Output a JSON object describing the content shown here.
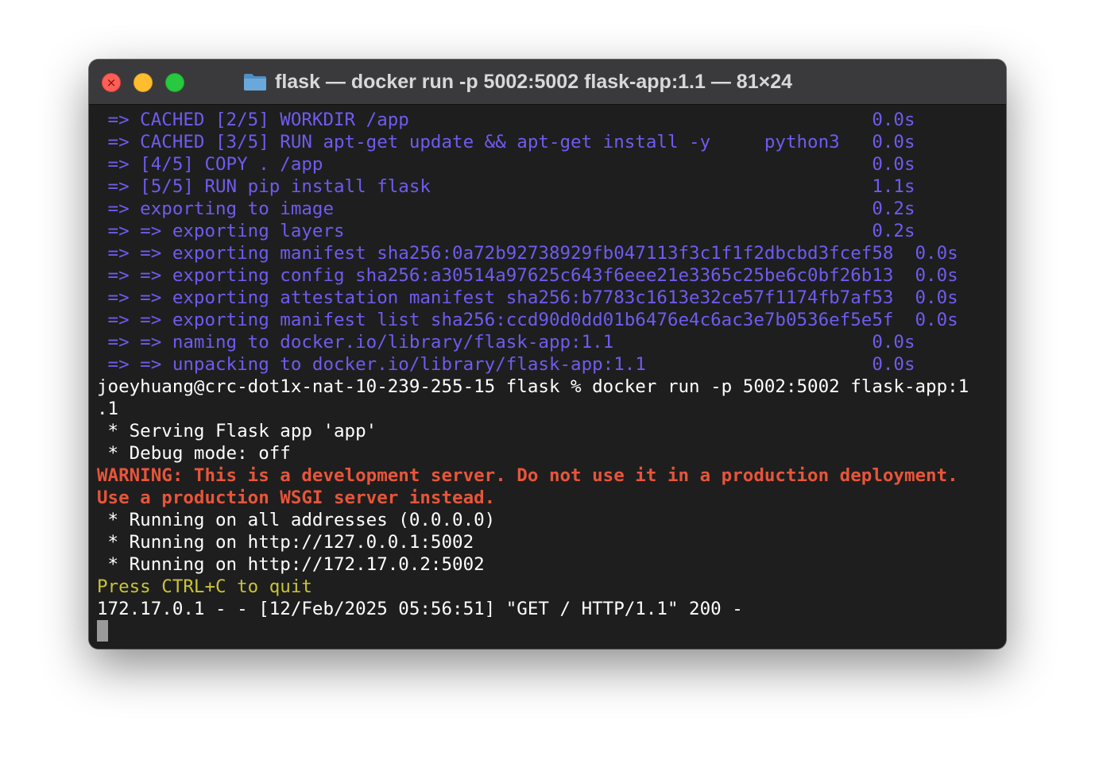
{
  "window": {
    "title": "flask — docker run -p 5002:5002 flask-app:1.1 — 81×24",
    "folder_icon": "folder-icon",
    "close_glyph": "×"
  },
  "colors": {
    "build": "#6e5cf0",
    "warning": "#e8553a",
    "yellow": "#c9c436",
    "text": "#ffffff",
    "background": "#1e1e1e"
  },
  "terminal": {
    "lines": [
      " => CACHED [2/5] WORKDIR /app                                           0.0s",
      " => CACHED [3/5] RUN apt-get update && apt-get install -y     python3   0.0s",
      " => [4/5] COPY . /app                                                   0.0s",
      " => [5/5] RUN pip install flask                                         1.1s",
      " => exporting to image                                                  0.2s",
      " => => exporting layers                                                 0.2s",
      " => => exporting manifest sha256:0a72b92738929fb047113f3c1f1f2dbcbd3fcef58  0.0s",
      " => => exporting config sha256:a30514a97625c643f6eee21e3365c25be6c0bf26b13  0.0s",
      " => => exporting attestation manifest sha256:b7783c1613e32ce57f1174fb7af53  0.0s",
      " => => exporting manifest list sha256:ccd90d0dd01b6476e4c6ac3e7b0536ef5e5f  0.0s",
      " => => naming to docker.io/library/flask-app:1.1                        0.0s",
      " => => unpacking to docker.io/library/flask-app:1.1                     0.0s",
      "joeyhuang@crc-dot1x-nat-10-239-255-15 flask % docker run -p 5002:5002 flask-app:1",
      ".1",
      " * Serving Flask app 'app'",
      " * Debug mode: off",
      "WARNING: This is a development server. Do not use it in a production deployment.",
      "Use a production WSGI server instead.",
      " * Running on all addresses (0.0.0.0)",
      " * Running on http://127.0.0.1:5002",
      " * Running on http://172.17.0.2:5002",
      "Press CTRL+C to quit",
      "172.17.0.1 - - [12/Feb/2025 05:56:51] \"GET / HTTP/1.1\" 200 -"
    ]
  }
}
